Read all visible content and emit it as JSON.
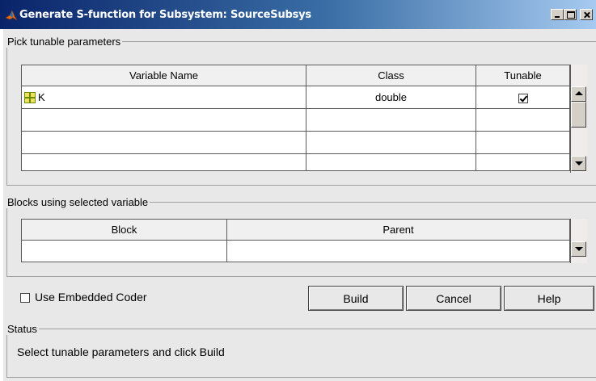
{
  "window": {
    "title": "Generate S-function for Subsystem: SourceSubsys",
    "icon": "matlab-icon"
  },
  "tunable_group": {
    "legend": "Pick tunable parameters",
    "columns": [
      "Variable Name",
      "Class",
      "Tunable"
    ],
    "rows": [
      {
        "name": "K",
        "class": "double",
        "tunable": true
      },
      {
        "name": "",
        "class": "",
        "tunable": null
      },
      {
        "name": "",
        "class": "",
        "tunable": null
      },
      {
        "name": "",
        "class": "",
        "tunable": null
      }
    ]
  },
  "blocks_group": {
    "legend": "Blocks using selected variable",
    "columns": [
      "Block",
      "Parent"
    ],
    "rows": [
      {
        "block": "",
        "parent": ""
      }
    ]
  },
  "options": {
    "use_embedded_coder_label": "Use Embedded Coder",
    "use_embedded_coder_checked": false
  },
  "buttons": {
    "build": "Build",
    "cancel": "Cancel",
    "help": "Help"
  },
  "status_group": {
    "legend": "Status",
    "text": "Select tunable parameters and click Build"
  }
}
